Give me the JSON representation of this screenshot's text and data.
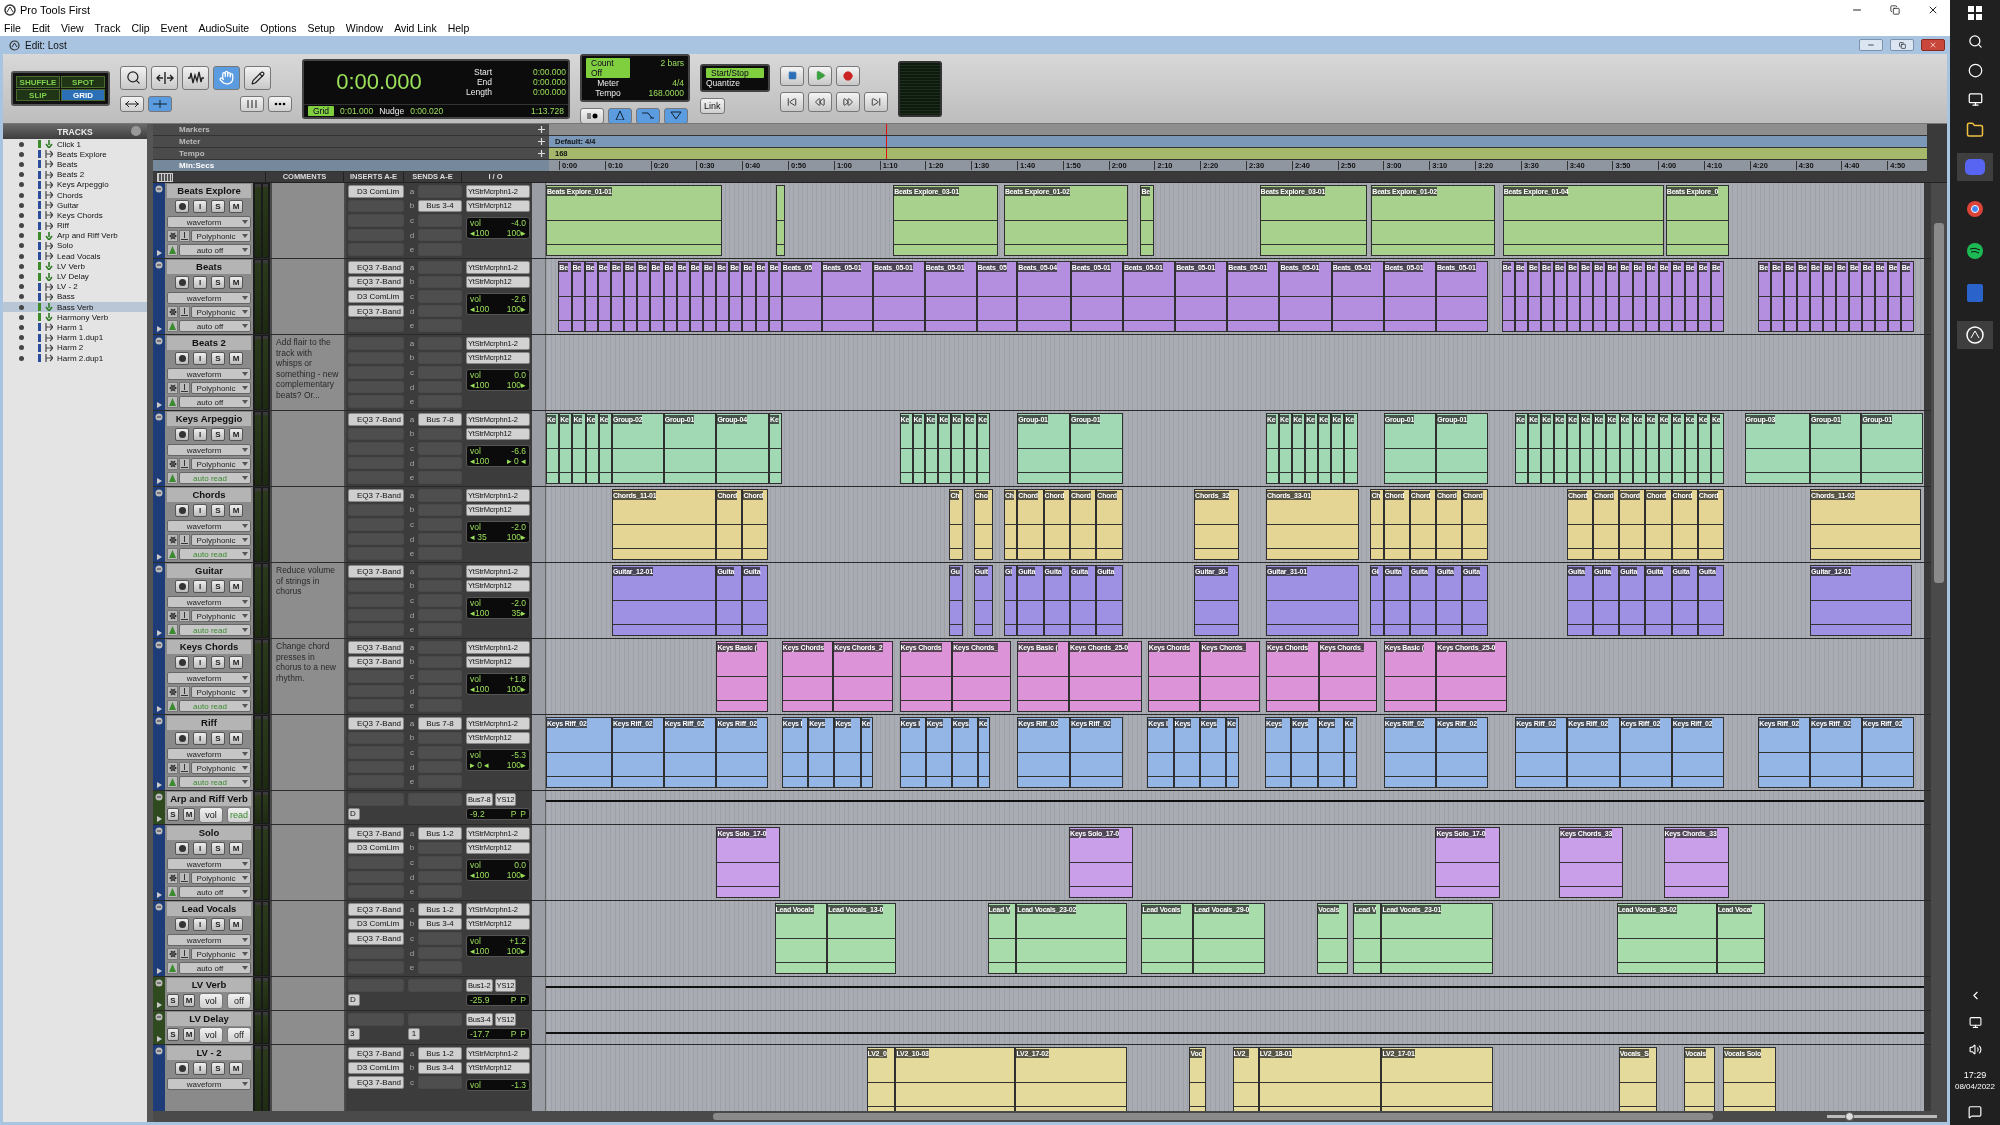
{
  "app_title": "Pro Tools First",
  "menu": [
    "File",
    "Edit",
    "View",
    "Track",
    "Clip",
    "Event",
    "AudioSuite",
    "Options",
    "Setup",
    "Window",
    "Avid Link",
    "Help"
  ],
  "window_title": "Edit: Lost",
  "edit_modes": [
    {
      "label": "SHUFFLE",
      "selected": false
    },
    {
      "label": "SPOT",
      "selected": false
    },
    {
      "label": "SLIP",
      "selected": false
    },
    {
      "label": "GRID",
      "selected": true
    }
  ],
  "tools": [
    {
      "kind": "zoom",
      "selected": false
    },
    {
      "kind": "trim",
      "selected": false
    },
    {
      "kind": "select",
      "selected": false
    },
    {
      "kind": "grab",
      "selected": true
    },
    {
      "kind": "pencil",
      "selected": false
    }
  ],
  "counter": {
    "main": "0:00.000",
    "start_label": "Start",
    "start": "0:00.000",
    "end_label": "End",
    "end": "0:00.000",
    "length_label": "Length",
    "length": "0:00.000",
    "grid_label": "Grid",
    "grid": "0:01.000",
    "nudge_label": "Nudge",
    "nudge": "0:00.020",
    "cursor": "1:13.728"
  },
  "midi": {
    "count_off": "Count Off",
    "bars": "2 bars",
    "meter_label": "Meter",
    "meter": "4/4",
    "tempo_label": "Tempo",
    "tempo": "168.0000"
  },
  "sync": {
    "start_stop": "Start/Stop",
    "quantize": "Quantize",
    "link": "Link"
  },
  "rulers": {
    "markers": "Markers",
    "meter": "Meter",
    "meter_value": "Default: 4/4",
    "tempo": "Tempo",
    "tempo_value": "168",
    "timebase": "Min:Secs",
    "ticks": [
      "0:00",
      "0:10",
      "0:20",
      "0:30",
      "0:40",
      "0:50",
      "1:00",
      "1:10",
      "1:20",
      "1:30",
      "1:40",
      "1:50",
      "2:00",
      "2:10",
      "2:20",
      "2:30",
      "2:40",
      "2:50",
      "3:00",
      "3:10",
      "3:20",
      "3:30",
      "3:40",
      "3:50",
      "4:00",
      "4:10",
      "4:20",
      "4:30",
      "4:40",
      "4:50"
    ]
  },
  "track_list": {
    "title": "TRACKS",
    "items": [
      {
        "name": "Click 1",
        "kind": "aux",
        "selected": false
      },
      {
        "name": "Beats Explore",
        "kind": "audio",
        "selected": false
      },
      {
        "name": "Beats",
        "kind": "audio",
        "selected": false
      },
      {
        "name": "Beats 2",
        "kind": "audio",
        "selected": false
      },
      {
        "name": "Keys Arpeggio",
        "kind": "audio",
        "selected": false
      },
      {
        "name": "Chords",
        "kind": "audio",
        "selected": false
      },
      {
        "name": "Guitar",
        "kind": "audio",
        "selected": false
      },
      {
        "name": "Keys Chords",
        "kind": "audio",
        "selected": false
      },
      {
        "name": "Riff",
        "kind": "audio",
        "selected": false
      },
      {
        "name": "Arp and Riff Verb",
        "kind": "aux",
        "selected": false
      },
      {
        "name": "Solo",
        "kind": "audio",
        "selected": false
      },
      {
        "name": "Lead Vocals",
        "kind": "audio",
        "selected": false
      },
      {
        "name": "LV Verb",
        "kind": "aux",
        "selected": false
      },
      {
        "name": "LV Delay",
        "kind": "aux",
        "selected": false
      },
      {
        "name": "LV - 2",
        "kind": "audio",
        "selected": false
      },
      {
        "name": "Bass",
        "kind": "audio",
        "selected": false
      },
      {
        "name": "Bass Verb",
        "kind": "aux",
        "selected": true
      },
      {
        "name": "Harmony Verb",
        "kind": "aux",
        "selected": false
      },
      {
        "name": "Harm 1",
        "kind": "audio",
        "selected": false
      },
      {
        "name": "Harm 1.dup1",
        "kind": "audio",
        "selected": false
      },
      {
        "name": "Harm 2",
        "kind": "audio",
        "selected": false
      },
      {
        "name": "Harm 2.dup1",
        "kind": "audio",
        "selected": false
      }
    ]
  },
  "columns": [
    "COMMENTS",
    "INSERTS A-E",
    "SENDS A-E",
    "I / O"
  ],
  "tracks": [
    {
      "kind": "audio",
      "name": "Beats Explore",
      "color": "#a9d18e",
      "buttons": [
        "I",
        "S",
        "M"
      ],
      "view": "waveform",
      "mode": "Polyphonic",
      "automation": "auto off",
      "automation_active": false,
      "inserts": [
        "D3 ComLim"
      ],
      "sends": [
        {
          "slot": "a"
        },
        {
          "slot": "b",
          "bus": "Bus 3-4"
        },
        {
          "slot": "c"
        },
        {
          "slot": "d"
        },
        {
          "slot": "e"
        }
      ],
      "input": "YtStrMcrphn1-2",
      "output": "YtStrMcrph12",
      "vol_label": "vol",
      "vol": "-4.0",
      "pan_left": "◂100",
      "pan_right": "100▸",
      "clips": [
        {
          "name": "Beats Explore_01-01"
        },
        {
          "name": "Beats Explore_03-01"
        },
        {
          "name": "Beats Explore_01-02"
        },
        {
          "name": "Be"
        },
        {
          "name": "Beats Explore_03-01"
        },
        {
          "name": "Beats Explore_01-02"
        },
        {
          "name": "Beats Explore_01-04"
        },
        {
          "name": "Beats Explore_0"
        }
      ]
    },
    {
      "kind": "audio",
      "name": "Beats",
      "color": "#b48fe0",
      "buttons": [
        "I",
        "S",
        "M"
      ],
      "view": "waveform",
      "mode": "Polyphonic",
      "automation": "auto off",
      "automation_active": false,
      "inserts": [
        "EQ3 7-Band",
        "EQ3 7-Band",
        "D3 ComLim",
        "EQ3 7-Band"
      ],
      "sends": [
        {
          "slot": "a"
        },
        {
          "slot": "b"
        },
        {
          "slot": "c"
        },
        {
          "slot": "d"
        },
        {
          "slot": "e"
        }
      ],
      "input": "YtStrMcrphn1-2",
      "output": "YtStrMcrph12",
      "vol_label": "vol",
      "vol": "-2.6",
      "pan_left": "◂100",
      "pan_right": "100▸",
      "clips": [
        {
          "names": [
            "Be",
            "Be",
            "Be",
            "Be",
            "Be",
            "Be",
            "Be",
            "Be",
            "Be",
            "Be",
            "Be",
            "Be",
            "Be",
            "Be",
            "Be",
            "Be",
            "Be"
          ]
        },
        {
          "name": "Beats_05"
        },
        {
          "name": "Beats_05-01"
        },
        {
          "name": "Beats_05-01"
        },
        {
          "name": "Beats_05-01"
        },
        {
          "name": "Beats_05"
        },
        {
          "name": "Beats_05-04"
        },
        {
          "names": [
            "Beats_05-01",
            "Beats_05-01",
            "Beats_05-01",
            "Beats_05-01",
            "Beats_05-01",
            "Beats_05-01",
            "Beats_05-01",
            "Beats_05-01"
          ]
        },
        {
          "names": [
            "Be",
            "Be",
            "Be",
            "Be",
            "Be",
            "Be",
            "Be",
            "Be",
            "Be",
            "Be",
            "Be",
            "Be",
            "Be",
            "Be",
            "Be",
            "Be",
            "Be"
          ]
        },
        {
          "names": [
            "Be",
            "Be",
            "Be",
            "Be",
            "Be",
            "Be",
            "Be",
            "Be",
            "Be",
            "Be",
            "Be",
            "Be"
          ]
        }
      ]
    },
    {
      "kind": "audio",
      "name": "Beats 2",
      "buttons": [
        "I",
        "S",
        "M"
      ],
      "view": "waveform",
      "mode": "Polyphonic",
      "automation": "auto off",
      "automation_active": false,
      "comment": "Add flair to the track with whisps or something - new complementary beats? Or...",
      "sends": [
        {
          "slot": "a"
        },
        {
          "slot": "b"
        },
        {
          "slot": "c"
        },
        {
          "slot": "d"
        },
        {
          "slot": "e"
        }
      ],
      "input": "YtStrMcrphn1-2",
      "output": "YtStrMcrph12",
      "vol_label": "vol",
      "vol": "0.0",
      "pan_left": "◂100",
      "pan_right": "100▸"
    },
    {
      "kind": "audio",
      "name": "Keys Arpeggio",
      "color": "#a0d9b4",
      "buttons": [
        "I",
        "S",
        "M"
      ],
      "view": "waveform",
      "mode": "Polyphonic",
      "automation": "auto read",
      "automation_active": true,
      "inserts": [
        "EQ3 7-Band"
      ],
      "sends": [
        {
          "slot": "a",
          "bus": "Bus 7-8"
        },
        {
          "slot": "b"
        },
        {
          "slot": "c"
        },
        {
          "slot": "d"
        },
        {
          "slot": "e"
        }
      ],
      "input": "YtStrMcrphn1-2",
      "output": "YtStrMcrph12",
      "vol_label": "vol",
      "vol": "-6.6",
      "pan_left": "◂100",
      "pan_right": "▸ 0 ◂",
      "clips": [
        {
          "names": [
            "Ke",
            "Ke",
            "Ke",
            "Ke",
            "Ke"
          ]
        },
        {
          "name": "Group-02"
        },
        {
          "name": "Group-01"
        },
        {
          "name": "Group-04"
        },
        {
          "name": "Ke"
        },
        {
          "names": [
            "Ke",
            "Ke",
            "Ke",
            "Ke",
            "Ke",
            "Ke",
            "Ke"
          ]
        },
        {
          "name": "Group-01"
        },
        {
          "name": "Group-01"
        },
        {
          "names": [
            "Ke",
            "Ke",
            "Ke",
            "Ke",
            "Ke",
            "Ke",
            "Ke"
          ]
        },
        {
          "name": "Group-01"
        },
        {
          "name": "Group-01"
        },
        {
          "names": [
            "Ke",
            "Ke",
            "Ke",
            "Ke",
            "Ke",
            "Ke",
            "Ke",
            "Ke",
            "Ke",
            "Ke",
            "Ke",
            "Ke",
            "Ke",
            "Ke",
            "Ke",
            "Ke"
          ]
        },
        {
          "name": "Group-03"
        },
        {
          "name": "Group-01"
        },
        {
          "name": "Group-01"
        }
      ]
    },
    {
      "kind": "audio",
      "name": "Chords",
      "color": "#e4d594",
      "buttons": [
        "I",
        "S",
        "M"
      ],
      "view": "waveform",
      "mode": "Polyphonic",
      "automation": "auto read",
      "automation_active": true,
      "inserts": [
        "EQ3 7-Band"
      ],
      "sends": [
        {
          "slot": "a"
        },
        {
          "slot": "b"
        },
        {
          "slot": "c"
        },
        {
          "slot": "d"
        },
        {
          "slot": "e"
        }
      ],
      "input": "YtStrMcrphn1-2",
      "output": "YtStrMcrph12",
      "vol_label": "vol",
      "vol": "-2.0",
      "pan_left": "◂ 35",
      "pan_right": "100▸",
      "clips": [
        {
          "name": "Chords_11-01"
        },
        {
          "name": "Chord"
        },
        {
          "name": "Chord"
        },
        {
          "name": "Ch"
        },
        {
          "name": "Cho"
        },
        {
          "name": "Ch"
        },
        {
          "names": [
            "Chord",
            "Chord",
            "Chord",
            "Chord"
          ]
        },
        {
          "name": "Chords_32"
        },
        {
          "name": "Chords_33-01"
        },
        {
          "name": "Ch"
        },
        {
          "names": [
            "Chord",
            "Chord",
            "Chord",
            "Chord"
          ]
        },
        {
          "names": [
            "Chord",
            "Chord",
            "Chord",
            "Chord",
            "Chord",
            "Chord"
          ]
        },
        {
          "name": "Chords_11-02"
        }
      ]
    },
    {
      "kind": "audio",
      "name": "Guitar",
      "color": "#9e90e3",
      "buttons": [
        "I",
        "S",
        "M"
      ],
      "view": "waveform",
      "mode": "Polyphonic",
      "automation": "auto read",
      "automation_active": true,
      "comment": "Reduce volume of strings in chorus",
      "inserts": [
        "EQ3 7-Band"
      ],
      "sends": [
        {
          "slot": "a"
        },
        {
          "slot": "b"
        },
        {
          "slot": "c"
        },
        {
          "slot": "d"
        },
        {
          "slot": "e"
        }
      ],
      "input": "YtStrMcrphn1-2",
      "output": "YtStrMcrph12",
      "vol_label": "vol",
      "vol": "-2.0",
      "pan_left": "◂100",
      "pan_right": "35▸",
      "clips": [
        {
          "name": "Guitar_12-01"
        },
        {
          "name": "Guita"
        },
        {
          "name": "Guita"
        },
        {
          "name": "Gu"
        },
        {
          "name": "Guit"
        },
        {
          "name": "Gi"
        },
        {
          "names": [
            "Guita",
            "Guita",
            "Guita",
            "Guita"
          ]
        },
        {
          "name": "Guitar_30-"
        },
        {
          "name": "Guitar_31-01"
        },
        {
          "name": "Gi"
        },
        {
          "names": [
            "Guita",
            "Guita",
            "Guita",
            "Guita"
          ]
        },
        {
          "names": [
            "Guita",
            "Guita",
            "Guita",
            "Guita",
            "Guita",
            "Guita"
          ]
        },
        {
          "name": "Guitar_12-01"
        }
      ]
    },
    {
      "kind": "audio",
      "name": "Keys Chords",
      "color": "#dd93d8",
      "buttons": [
        "I",
        "S",
        "M"
      ],
      "view": "waveform",
      "mode": "Polyphonic",
      "automation": "auto read",
      "automation_active": true,
      "comment": "Change chord presses in chorus to a new rhythm.",
      "inserts": [
        "EQ3 7-Band",
        "EQ3 7-Band"
      ],
      "sends": [
        {
          "slot": "a"
        },
        {
          "slot": "b"
        },
        {
          "slot": "c"
        },
        {
          "slot": "d"
        },
        {
          "slot": "e"
        }
      ],
      "input": "YtStrMcrphn1-2",
      "output": "YtStrMcrph12",
      "vol_label": "vol",
      "vol": "+1.8",
      "pan_left": "◂100",
      "pan_right": "100▸",
      "clips": [
        {
          "name": "Keys Basic ("
        },
        {
          "name": "Keys Chords"
        },
        {
          "name": "Keys Chords_2"
        },
        {
          "name": "Keys Chords"
        },
        {
          "name": "Keys Chords_"
        },
        {
          "name": "Keys Basic ("
        },
        {
          "name": "Keys Chords_25-0"
        },
        {
          "name": "Keys Chords"
        },
        {
          "name": "Keys Chords_"
        },
        {
          "name": "Keys Chords"
        },
        {
          "name": "Keys Chords_"
        },
        {
          "name": "Keys Basic ("
        },
        {
          "name": "Keys Chords_25-0"
        }
      ]
    },
    {
      "kind": "audio",
      "name": "Riff",
      "color": "#94b6e6",
      "buttons": [
        "I",
        "S",
        "M"
      ],
      "view": "waveform",
      "mode": "Polyphonic",
      "automation": "auto read",
      "automation_active": true,
      "inserts": [
        "EQ3 7-Band"
      ],
      "sends": [
        {
          "slot": "a",
          "bus": "Bus 7-8"
        },
        {
          "slot": "b"
        },
        {
          "slot": "c"
        },
        {
          "slot": "d"
        },
        {
          "slot": "e"
        }
      ],
      "input": "YtStrMcrphn1-2",
      "output": "YtStrMcrph12",
      "vol_label": "vol",
      "vol": "-5.3",
      "pan_left": "▸ 0 ◂",
      "pan_right": "100▸",
      "clips": [
        {
          "name": "Keys Riff_02"
        },
        {
          "name": "Keys Riff_02"
        },
        {
          "name": "Keys Riff_02"
        },
        {
          "name": "Keys Riff_02"
        },
        {
          "names": [
            "Keys I",
            "Keys",
            "Keys"
          ]
        },
        {
          "name": "Ke"
        },
        {
          "names": [
            "Keys I",
            "Keys",
            "Keys"
          ]
        },
        {
          "name": "Ke"
        },
        {
          "name": "Keys Riff_02"
        },
        {
          "name": "Keys Riff_02"
        },
        {
          "names": [
            "Keys I",
            "Keys",
            "Keys"
          ]
        },
        {
          "name": "Ke"
        },
        {
          "names": [
            "Keys",
            "Keys",
            "Keys"
          ]
        },
        {
          "name": "Ke"
        },
        {
          "name": "Keys Riff_02"
        },
        {
          "name": "Keys Riff_02"
        },
        {
          "names": [
            "Keys Riff_02",
            "Keys Riff_02",
            "Keys Riff_02",
            "Keys Riff_02"
          ]
        },
        {
          "names": [
            "Keys Riff_02",
            "Keys Riff_02",
            "Keys Riff_02"
          ]
        }
      ]
    },
    {
      "kind": "aux",
      "name": "Arp and Riff Verb",
      "buttons": [
        "S",
        "M"
      ],
      "vol_button": "vol",
      "automation": "read",
      "automation_active": true,
      "insert_mark": "D",
      "output": "Bus7-8",
      "output_2": "YS12",
      "vol": "-9.2",
      "pan_left": "P",
      "pan_right": "P"
    },
    {
      "kind": "audio",
      "name": "Solo",
      "color": "#c99fe9",
      "buttons": [
        "I",
        "S",
        "M"
      ],
      "view": "waveform",
      "mode": "Polyphonic",
      "automation": "auto off",
      "automation_active": false,
      "inserts": [
        "EQ3 7-Band",
        "D3 ComLim"
      ],
      "sends": [
        {
          "slot": "a",
          "bus": "Bus 1-2"
        },
        {
          "slot": "b"
        },
        {
          "slot": "c"
        },
        {
          "slot": "d"
        },
        {
          "slot": "e"
        }
      ],
      "input": "YtStrMcrphn1-2",
      "output": "YtStrMcrph12",
      "vol_label": "vol",
      "vol": "0.0",
      "pan_left": "◂100",
      "pan_right": "100▸",
      "clips": [
        {
          "name": "Keys Solo_17-0"
        },
        {
          "name": "Keys Solo_17-0"
        },
        {
          "name": "Keys Solo_17-0"
        },
        {
          "name": "Keys Chords_33"
        },
        {
          "name": "Keys Chords_33"
        }
      ]
    },
    {
      "kind": "audio",
      "name": "Lead Vocals",
      "color": "#a8dcab",
      "buttons": [
        "I",
        "S",
        "M"
      ],
      "view": "waveform",
      "mode": "Polyphonic",
      "automation": "auto off",
      "automation_active": false,
      "inserts": [
        "EQ3 7-Band",
        "D3 ComLim",
        "EQ3 7-Band"
      ],
      "sends": [
        {
          "slot": "a",
          "bus": "Bus 1-2"
        },
        {
          "slot": "b",
          "bus": "Bus 3-4"
        },
        {
          "slot": "c"
        },
        {
          "slot": "d"
        },
        {
          "slot": "e"
        }
      ],
      "input": "YtStrMcrphn1-2",
      "output": "YtStrMcrph12",
      "vol_label": "vol",
      "vol": "+1.2",
      "pan_left": "◂100",
      "pan_right": "100▸",
      "clips": [
        {
          "name": "Lead Vocals"
        },
        {
          "name": "Lead Vocals_13-0"
        },
        {
          "name": "Lead V"
        },
        {
          "name": "Lead Vocals_23-02"
        },
        {
          "name": "Lead Vocals"
        },
        {
          "name": "Lead Vocals_29-0"
        },
        {
          "name": "Vocals"
        },
        {
          "name": "Lead V"
        },
        {
          "name": "Lead Vocals_23-01"
        },
        {
          "name": "Lead Vocals_35-02"
        },
        {
          "name": "Lead Vocal"
        }
      ]
    },
    {
      "kind": "aux",
      "name": "LV Verb",
      "buttons": [
        "S",
        "M"
      ],
      "vol_button": "vol",
      "automation": "off",
      "automation_active": false,
      "insert_mark": "D",
      "output": "Bus1-2",
      "output_2": "YS12",
      "vol": "-25.9",
      "pan_left": "P",
      "pan_right": "P"
    },
    {
      "kind": "aux",
      "name": "LV Delay",
      "buttons": [
        "S",
        "M"
      ],
      "vol_button": "vol",
      "automation": "off",
      "automation_active": false,
      "insert_mark": "3",
      "send_mark": "1",
      "output": "Bus3-4",
      "output_2": "YS12",
      "vol": "-17.7",
      "pan_left": "P",
      "pan_right": "P"
    },
    {
      "kind": "audio",
      "name": "LV - 2",
      "color": "#e4da9c",
      "buttons": [
        "I",
        "S",
        "M"
      ],
      "view": "waveform",
      "inserts": [
        "EQ3 7-Band",
        "D3 ComLim",
        "EQ3 7-Band"
      ],
      "sends": [
        {
          "slot": "a",
          "bus": "Bus 1-2"
        },
        {
          "slot": "b",
          "bus": "Bus 3-4"
        },
        {
          "slot": "c"
        }
      ],
      "input": "YtStrMcrphn1-2",
      "output": "YtStrMcrph12",
      "vol_label": "vol",
      "vol": "-1.3",
      "clips": [
        {
          "name": "LV2_0"
        },
        {
          "name": "LV2_10-03"
        },
        {
          "name": "LV2_17-02"
        },
        {
          "name": "Voc"
        },
        {
          "name": "LV2_"
        },
        {
          "name": "LV2_18-01"
        },
        {
          "name": "LV2_17-01"
        },
        {
          "name": "Vocals_S"
        },
        {
          "name": "Vocals"
        },
        {
          "name": "Vocals Solo"
        }
      ]
    }
  ],
  "zoom_slider": {
    "level": 0.2
  },
  "taskbar": {
    "time": "17:29",
    "date": "08/04/2022"
  }
}
